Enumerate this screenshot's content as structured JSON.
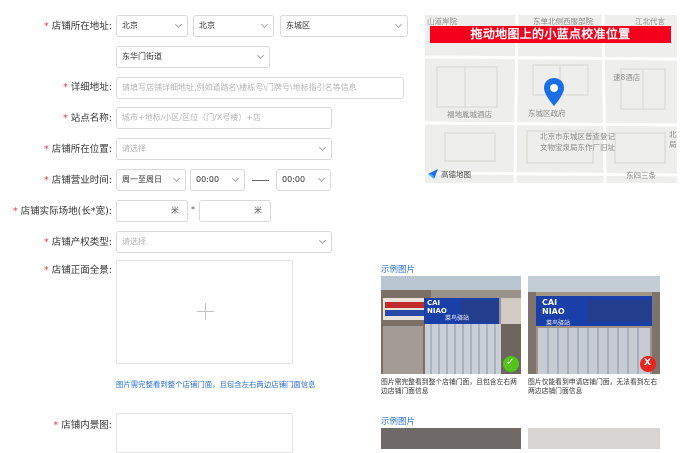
{
  "form": {
    "address": {
      "label": "店铺所在地址:",
      "province": "北京",
      "city": "北京",
      "district": "东城区",
      "street": "东华门街道"
    },
    "detail_address": {
      "label": "详细地址:",
      "placeholder": "请填写店铺详细地址,例如道路名\\楼栋号\\门牌号\\地标指引名等信息"
    },
    "site_name": {
      "label": "站点名称:",
      "placeholder": "城市+地标/小区/区位（门/X号楼）+店"
    },
    "location": {
      "label": "店铺所在位置:",
      "placeholder": "请选择"
    },
    "business_hours": {
      "label": "店铺营业时间:",
      "days": "周一至周日",
      "start": "00:00",
      "end": "00:00"
    },
    "area": {
      "label": "店铺实际场地(长*宽):",
      "unit1": "米",
      "separator": "*",
      "unit2": "米"
    },
    "property_type": {
      "label": "店铺产权类型:",
      "placeholder": "请选择"
    },
    "front_photo": {
      "label": "店铺正面全景:",
      "tip": "图片需完整看到整个店铺门面，且包含左右两边店铺门面信息",
      "example_title": "示例图片",
      "good_caption": "图片需完整看到整个店铺门面，且包含左右两边店铺门面信息",
      "bad_caption": "图片仅能看到申请店铺门面，无法看到左右两边店铺门面信息"
    },
    "interior_photo": {
      "label": "店铺内景图:",
      "example_title": "示例图片"
    }
  },
  "map": {
    "banner": "拖动地图上的小蓝点校准位置",
    "labels": {
      "top_left": "山道岸院",
      "top_mid": "东单北侧西服部院",
      "top_right": "江北代言",
      "hotel1": "速8酒店",
      "hotel2": "福地胤城酒店",
      "gov": "东城区政府",
      "heritage_line1": "北京市东城区普查登记",
      "heritage_line2": "文物宝泉局东作厂旧址",
      "edge_right1": "北",
      "edge_right2": "局",
      "street": "东四三条",
      "brand": "高德地图"
    }
  },
  "example_photos": {
    "sign_brand_top": "CAI",
    "sign_brand_bottom": "NIAO",
    "sign_name": "菜鸟驿站",
    "good_mark": "✓",
    "bad_mark": "X"
  },
  "colors": {
    "required": "#e4393c",
    "link": "#2a6fd6",
    "banner": "#f5001c",
    "pin": "#1a6fe6",
    "good": "#52c41a",
    "bad": "#e8251f"
  }
}
